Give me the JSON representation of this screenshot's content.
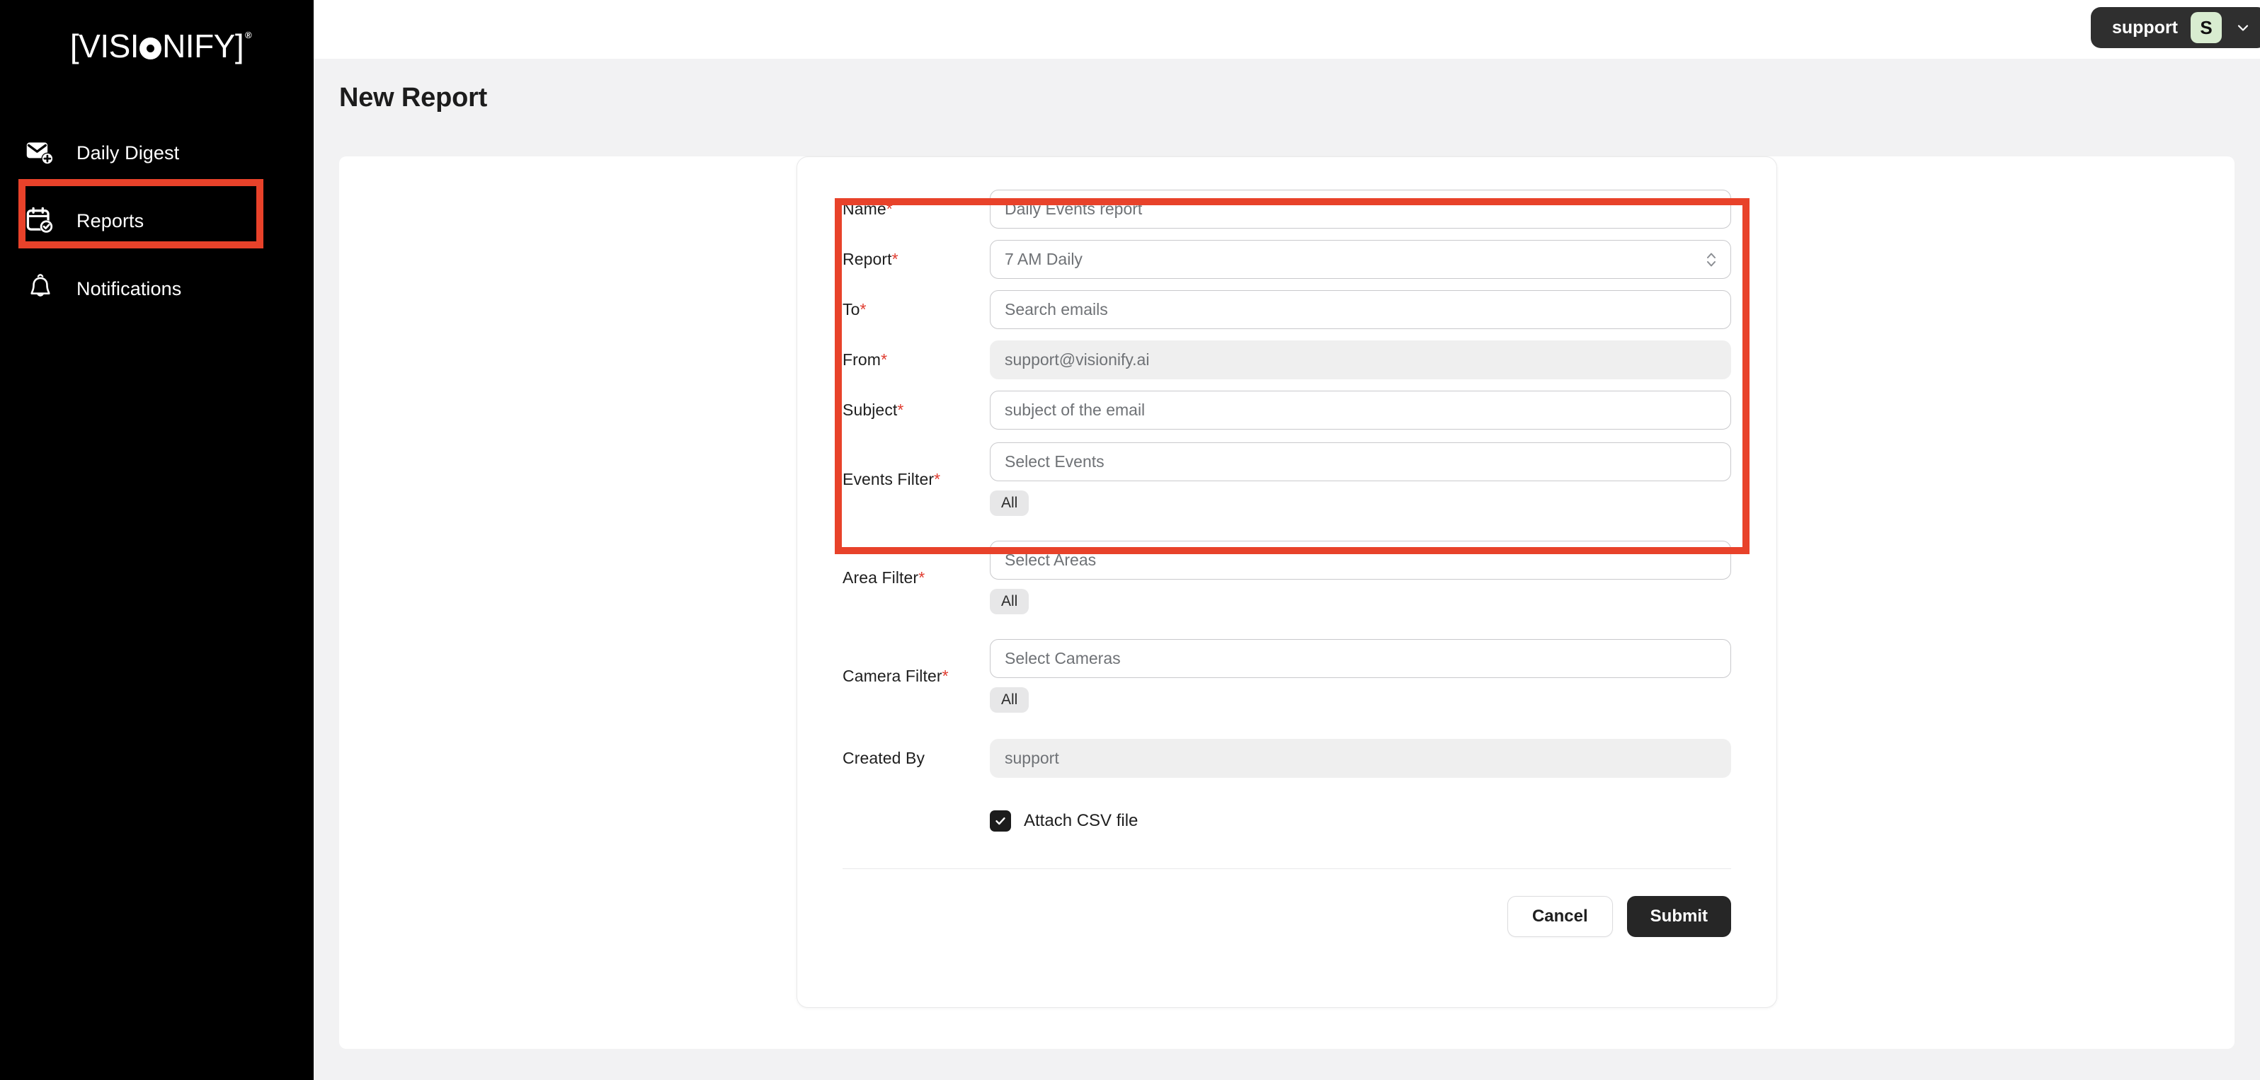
{
  "brand": {
    "name": "VISIONIFY",
    "prefix": "[VISI",
    "suffix": "NIFY]",
    "trademark": "®"
  },
  "sidebar": {
    "items": [
      {
        "label": "Daily Digest",
        "icon": "mail-plus-icon",
        "active": false
      },
      {
        "label": "Reports",
        "icon": "calendar-check-icon",
        "active": true
      },
      {
        "label": "Notifications",
        "icon": "bell-icon",
        "active": false
      }
    ]
  },
  "topbar": {
    "user_name": "support",
    "avatar_initial": "S",
    "avatar_bg": "#d8ecd0",
    "chevron_icon": "chevron-down-icon"
  },
  "header": {
    "title": "New Report"
  },
  "form": {
    "fields": {
      "name": {
        "label": "Name",
        "required": "*",
        "value": "Daily Events report",
        "placeholder": "Daily Events report"
      },
      "report": {
        "label": "Report",
        "required": "*",
        "value": "7 AM Daily",
        "options": [
          "7 AM Daily"
        ]
      },
      "to": {
        "label": "To",
        "required": "*",
        "value": "",
        "placeholder": "Search emails"
      },
      "from": {
        "label": "From",
        "required": "*",
        "value": "support@visionify.ai",
        "disabled": true
      },
      "subject": {
        "label": "Subject",
        "required": "*",
        "value": "",
        "placeholder": "subject of the email"
      },
      "events_filter": {
        "label": "Events Filter",
        "required": "*",
        "placeholder": "Select Events",
        "chip": "All"
      },
      "area_filter": {
        "label": "Area Filter",
        "required": "*",
        "placeholder": "Select Areas",
        "chip": "All"
      },
      "camera_filter": {
        "label": "Camera Filter",
        "required": "*",
        "placeholder": "Select Cameras",
        "chip": "All"
      },
      "created_by": {
        "label": "Created By",
        "required": "",
        "value": "support",
        "disabled": true
      }
    },
    "attach_csv": {
      "label": "Attach CSV file",
      "checked": true
    },
    "actions": {
      "cancel_label": "Cancel",
      "submit_label": "Submit"
    }
  },
  "annotation": {
    "highlight_color": "#e8422a",
    "sidebar_highlight_color": "#e8422a"
  }
}
